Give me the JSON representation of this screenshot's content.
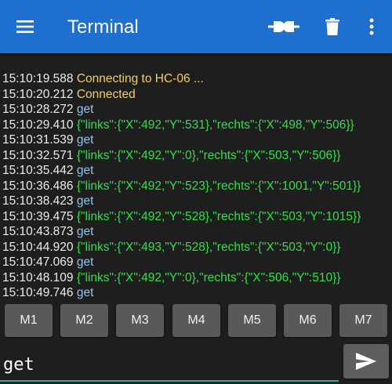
{
  "app": {
    "title": "Terminal"
  },
  "toolbar": {
    "menu_icon": "hamburger-menu-icon",
    "connect_icon": "connect-plug-icon",
    "clear_icon": "trash-icon",
    "more_icon": "more-vert-icon"
  },
  "colors": {
    "appbar": "#1e6fcf",
    "background": "#1e1e1e",
    "timestamp": "#ececec",
    "status": "#f0d060",
    "sent": "#8fc4f0",
    "received": "#2fe04a",
    "button": "#595959",
    "underline": "#2aa8a8"
  },
  "log": [
    {
      "time": "15:10:19.588",
      "text": " Connecting to HC-06 ...",
      "kind": "status"
    },
    {
      "time": "15:10:20.212",
      "text": " Connected",
      "kind": "status"
    },
    {
      "time": "15:10:28.272",
      "text": " get",
      "kind": "sent"
    },
    {
      "time": "15:10:29.410",
      "text": " {\"links\":{\"X\":492,\"Y\":531},\"rechts\":{\"X\":498,\"Y\":506}}",
      "kind": "recv"
    },
    {
      "time": "15:10:31.539",
      "text": " get",
      "kind": "sent"
    },
    {
      "time": "15:10:32.571",
      "text": " {\"links\":{\"X\":492,\"Y\":0},\"rechts\":{\"X\":503,\"Y\":506}}",
      "kind": "recv"
    },
    {
      "time": "15:10:35.442",
      "text": " get",
      "kind": "sent"
    },
    {
      "time": "15:10:36.486",
      "text": " {\"links\":{\"X\":492,\"Y\":523},\"rechts\":{\"X\":1001,\"Y\":501}}",
      "kind": "recv"
    },
    {
      "time": "15:10:38.423",
      "text": " get",
      "kind": "sent"
    },
    {
      "time": "15:10:39.475",
      "text": " {\"links\":{\"X\":492,\"Y\":528},\"rechts\":{\"X\":503,\"Y\":1015}}",
      "kind": "recv"
    },
    {
      "time": "15:10:43.873",
      "text": " get",
      "kind": "sent"
    },
    {
      "time": "15:10:44.920",
      "text": " {\"links\":{\"X\":493,\"Y\":528},\"rechts\":{\"X\":503,\"Y\":0}}",
      "kind": "recv"
    },
    {
      "time": "15:10:47.069",
      "text": " get",
      "kind": "sent"
    },
    {
      "time": "15:10:48.109",
      "text": " {\"links\":{\"X\":492,\"Y\":0},\"rechts\":{\"X\":506,\"Y\":510}}",
      "kind": "recv"
    },
    {
      "time": "15:10:49.746",
      "text": " get",
      "kind": "sent"
    }
  ],
  "macros": [
    "M1",
    "M2",
    "M3",
    "M4",
    "M5",
    "M6",
    "M7"
  ],
  "input": {
    "value": "get"
  },
  "send": {
    "icon": "send-icon"
  }
}
